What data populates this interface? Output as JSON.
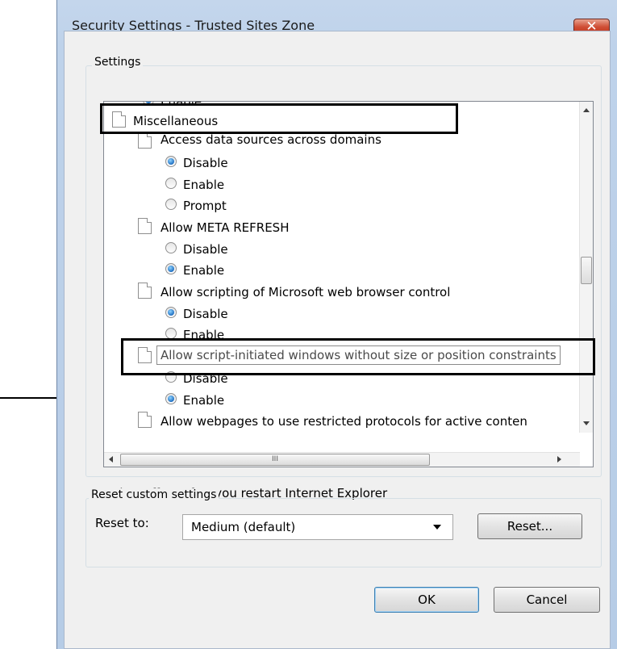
{
  "dialog": {
    "title": "Security Settings - Trusted Sites Zone",
    "close_glyph": "✕"
  },
  "settings_group": {
    "label": "Settings"
  },
  "tree": {
    "top_enable": "Enable",
    "misc": "Miscellaneous",
    "access_data": "Access data sources across domains",
    "access_disable": "Disable",
    "access_enable": "Enable",
    "access_prompt": "Prompt",
    "meta": "Allow META REFRESH",
    "meta_disable": "Disable",
    "meta_enable": "Enable",
    "scripting": "Allow scripting of Microsoft web browser control",
    "scripting_disable": "Disable",
    "scripting_enable": "Enable",
    "script_windows": "Allow script-initiated windows without size or position constraints",
    "sw_disable": "Disable",
    "sw_enable": "Enable",
    "webpages": "Allow webpages to use restricted protocols for active conten"
  },
  "hscroll_grip": "III",
  "note": "*Takes effect after you restart Internet Explorer",
  "reset_group": {
    "label": "Reset custom settings",
    "reset_to_label": "Reset to:",
    "combo_value": "Medium (default)",
    "reset_button": "Reset..."
  },
  "buttons": {
    "ok": "OK",
    "cancel": "Cancel"
  },
  "colors": {
    "frame": "#bed2ea",
    "close": "#cf4d34",
    "radio_selected": "#1f6fc2"
  }
}
